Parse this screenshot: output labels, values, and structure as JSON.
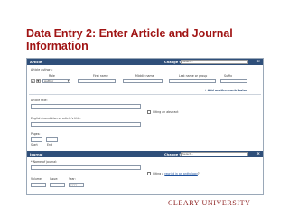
{
  "slide": {
    "title": "Data Entry 2:  Enter Article and Journal Information",
    "logo_text": "CLEARY UNIVERSITY"
  },
  "article": {
    "bar_title": "Article",
    "change_to_label": "Change to:",
    "change_to_value": "Select...",
    "authors_label": "Article authors:",
    "columns": {
      "role": "Role",
      "first_name": "First name",
      "middle_name": "Middle name",
      "last_name": "Last name or group",
      "suffix": "Suffix"
    },
    "role_value": "Author",
    "up_arrow": "▲",
    "down_arrow": "▼",
    "add_contributor": "Add another contributor",
    "title_label": "Article title:",
    "citing_abstract": "Citing an abstract",
    "translation_label": "English translation of article's title:",
    "pages_label": "Pages:",
    "start_label": "Start",
    "end_label": "End"
  },
  "journal": {
    "bar_title": "Journal",
    "change_to_label": "Change to:",
    "change_to_value": "Select...",
    "name_label": "* Name of journal:",
    "citing_prefix": "Citing a",
    "citing_link": "reprint in an anthology",
    "citing_suffix": "?",
    "volume_label": "Volume:",
    "issue_label": "Issue:",
    "year_label": "Year:",
    "year_placeholder": "YYYY"
  }
}
